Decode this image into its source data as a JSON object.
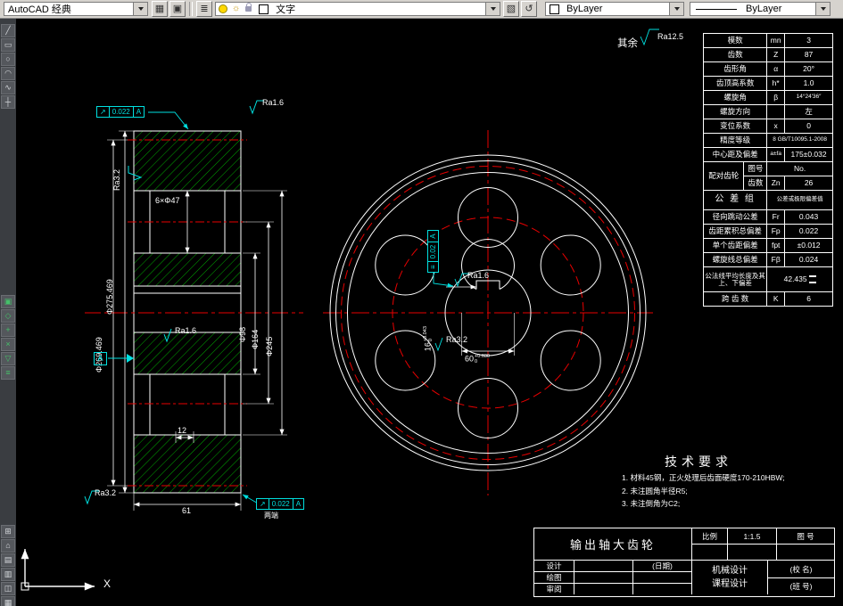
{
  "colors": {
    "background": "#000000",
    "line": "#ffffff",
    "centerline": "#e80000",
    "hatch": "#00a800",
    "annotation": "#00e0e0",
    "toolbar_bg": "#d6d3ce"
  },
  "toolbar": {
    "workspace": "AutoCAD 经典",
    "layer_name": "文字",
    "freeze_glyph": "☼",
    "color_value": "ByLayer",
    "linetype_value": "ByLayer",
    "btn_glyphs": [
      "▦",
      "▣",
      "≣",
      "▧",
      "↺"
    ]
  },
  "side_toolbar": {
    "top": [
      "╱",
      "▭",
      "○",
      "◠",
      "∿",
      "┼"
    ],
    "mid": [
      "▣",
      "◇",
      "+",
      "×",
      "▽",
      "≡"
    ],
    "bottom": [
      "⊞",
      "⌂",
      "▤",
      "▥",
      "◫",
      "▦"
    ]
  },
  "drawing": {
    "general_prefix": "其余",
    "general_roughness": "Ra12.5",
    "dims": {
      "holes": "6×Φ47",
      "tip": "Φ275.469",
      "pitch": "Φ269.469",
      "hub": "Φ98",
      "bolt": "Φ164",
      "rim": "Φ245",
      "width": "61",
      "web": "12",
      "keyway_main": "16",
      "keyway_tol_up": "+0.043",
      "keyway_tol_dn": "0",
      "bore_main": "60",
      "bore_tol_up": "+0.030",
      "bore_tol_dn": "0"
    },
    "roughness": {
      "top": "Ra1.6",
      "left": "Ra3.2",
      "mid": "Ra1.6",
      "bottom": "Ra3.2",
      "keyway": "Ra1.6",
      "bore": "Ra3.2"
    },
    "gdt": {
      "top": {
        "sym": "↗",
        "tol": "0.022",
        "datum": "A"
      },
      "bottom": {
        "sym": "↗",
        "tol": "0.022",
        "datum": "A",
        "note": "两端"
      },
      "key": {
        "sym": "≡",
        "tol": "0.02",
        "datum": "A"
      }
    },
    "datum_label": "A",
    "tech": {
      "title": "技术要求",
      "items": [
        "1. 材料45钢，正火处理后齿面硬度170-210HBW;",
        "2. 未注圆角半径R5;",
        "3. 未注倒角为C2;"
      ]
    },
    "ucs_x": "X"
  },
  "param_table": {
    "rows": [
      {
        "label": "模数",
        "sym": "mn",
        "val": "3"
      },
      {
        "label": "齿数",
        "sym": "Z",
        "val": "87"
      },
      {
        "label": "齿形角",
        "sym": "α",
        "val": "20°"
      },
      {
        "label": "齿顶高系数",
        "sym": "h*",
        "val": "1.0"
      },
      {
        "label": "螺旋角",
        "sym": "β",
        "val": "14°24′36″"
      },
      {
        "label": "螺旋方向",
        "sym": "",
        "val": "左"
      },
      {
        "label": "变位系数",
        "sym": "x",
        "val": "0"
      },
      {
        "label": "精度等级",
        "val": "8 GB/T10095.1-2008"
      },
      {
        "label": "中心距及偏差",
        "sym": "a±fa",
        "val": "175±0.032"
      },
      {
        "label": "配对齿轮",
        "sub1": "图号",
        "val1": "No.",
        "sub2": "齿数",
        "sym2": "Zn",
        "val2": "26"
      },
      {
        "label": "公 差 组",
        "val": "公差或极限偏差值"
      },
      {
        "label": "径向跳动公差",
        "sym": "Fr",
        "val": "0.043"
      },
      {
        "label": "齿距累积总偏差",
        "sym": "Fp",
        "val": "0.022"
      },
      {
        "label": "单个齿距偏差",
        "sym": "fpt",
        "val": "±0.012"
      },
      {
        "label": "螺旋线总偏差",
        "sym": "Fβ",
        "val": "0.024"
      },
      {
        "label": "公法线平均长度及其上、下偏差",
        "val": "42.435"
      },
      {
        "label": "跨 齿 数",
        "sym": "K",
        "val": "6"
      }
    ]
  },
  "title_block": {
    "title": "输出轴大齿轮",
    "scale_label": "比例",
    "scale_val": "1:1.5",
    "drawing_no_label": "图 号",
    "designer_label": "设计",
    "date_label": "(日期)",
    "drafter_label": "绘图",
    "reviewer_label": "审阅",
    "course_line1": "机械设计",
    "course_line2": "课程设计",
    "school": "(校 名)",
    "class": "(班 号)"
  }
}
